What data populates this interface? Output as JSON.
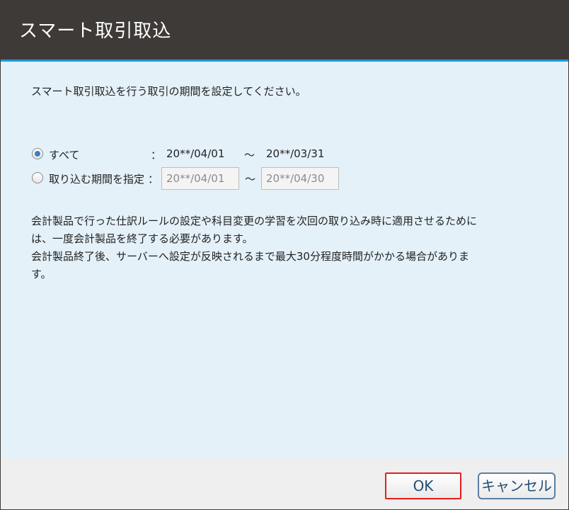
{
  "dialog": {
    "title": "スマート取引取込",
    "intro": "スマート取引取込を行う取引の期間を設定してください。",
    "options": {
      "all": {
        "label": "すべて",
        "selected": true,
        "colon": "：",
        "start": "20**/04/01",
        "tilde": "～",
        "end": "20**/03/31"
      },
      "range": {
        "label": "取り込む期間を指定",
        "selected": false,
        "colon": "：",
        "start_value": "20**/04/01",
        "tilde": "～",
        "end_value": "20**/04/30"
      }
    },
    "notes": [
      "会計製品で行った仕訳ルールの設定や科目変更の学習を次回の取り込み時に適用させるために",
      "は、一度会計製品を終了する必要があります。",
      "会計製品終了後、サーバーへ設定が反映されるまで最大30分程度時間がかかる場合がありま",
      "す。"
    ],
    "buttons": {
      "ok_label": "OK",
      "cancel_label": "キャンセル"
    }
  },
  "colors": {
    "title_bg": "#3e3a38",
    "title_accent": "#1f9ad6",
    "content_bg": "#e4f1f8",
    "footer_bg": "#efefef",
    "ok_highlight": "#e61e1e"
  }
}
